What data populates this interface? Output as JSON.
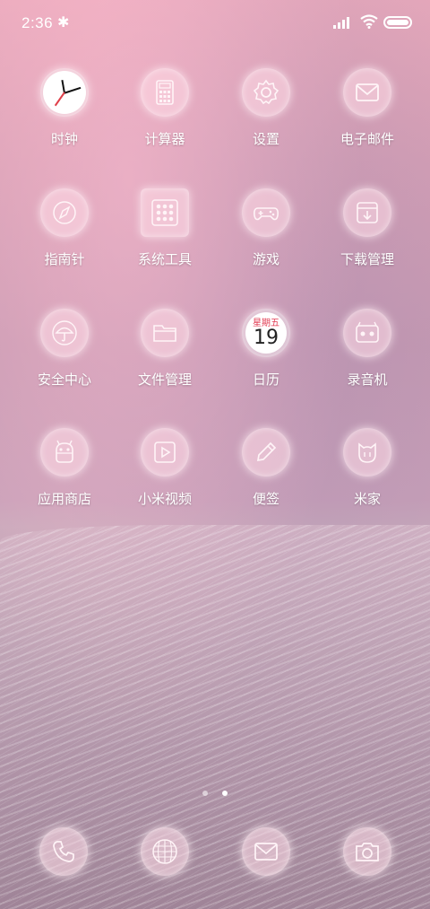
{
  "status_bar": {
    "time": "2:36",
    "bluetooth": "bluetooth-icon",
    "signal": "signal-icon",
    "wifi": "wifi-icon",
    "battery": "battery-icon"
  },
  "apps": [
    {
      "label": "时钟",
      "icon": "clock-icon"
    },
    {
      "label": "计算器",
      "icon": "calculator-icon"
    },
    {
      "label": "设置",
      "icon": "gear-icon"
    },
    {
      "label": "电子邮件",
      "icon": "email-icon"
    },
    {
      "label": "指南针",
      "icon": "compass-icon"
    },
    {
      "label": "系统工具",
      "icon": "tools-grid-icon"
    },
    {
      "label": "游戏",
      "icon": "gamepad-icon"
    },
    {
      "label": "下载管理",
      "icon": "download-icon"
    },
    {
      "label": "安全中心",
      "icon": "umbrella-icon"
    },
    {
      "label": "文件管理",
      "icon": "folder-icon"
    },
    {
      "label": "日历",
      "icon": "calendar-icon",
      "weekday": "星期五",
      "day": "19"
    },
    {
      "label": "录音机",
      "icon": "recorder-icon"
    },
    {
      "label": "应用商店",
      "icon": "android-icon"
    },
    {
      "label": "小米视频",
      "icon": "play-icon"
    },
    {
      "label": "便签",
      "icon": "pencil-icon"
    },
    {
      "label": "米家",
      "icon": "mi-home-icon"
    }
  ],
  "page_indicator": {
    "pages": 2,
    "active": 2
  },
  "dock": [
    {
      "icon": "phone-icon"
    },
    {
      "icon": "browser-globe-icon"
    },
    {
      "icon": "messages-icon"
    },
    {
      "icon": "camera-icon"
    }
  ],
  "colors": {
    "glyph": "#fff4f7",
    "label": "#ffffff",
    "accent_red": "#e23b52"
  }
}
